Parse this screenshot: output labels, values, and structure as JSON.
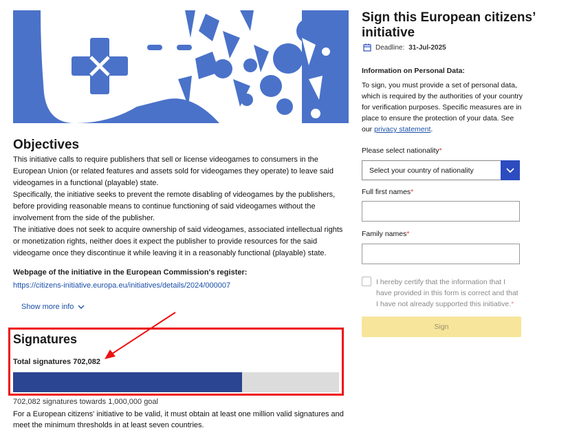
{
  "hero": {
    "image": "videogame-controller-illustration"
  },
  "objectives": {
    "title": "Objectives",
    "paragraphs": [
      "This initiative calls to require publishers that sell or license videogames to consumers in the European Union (or related features and assets sold for videogames they operate) to leave said videogames in a functional (playable) state.",
      "Specifically, the initiative seeks to prevent the remote disabling of videogames by the publishers, before providing reasonable means to continue functioning of said videogames without the involvement from the side of the publisher.",
      "The initiative does not seek to acquire ownership of said videogames, associated intellectual rights or monetization rights, neither does it expect the publisher to provide resources for the said videogame once they discontinue it while leaving it in a reasonably functional (playable) state."
    ],
    "webpage_label": "Webpage of the initiative in the European Commission's register:",
    "webpage_link": "https://citizens-initiative.europa.eu/initiatives/details/2024/000007",
    "show_more": "Show more info"
  },
  "signatures": {
    "title": "Signatures",
    "total_label": "Total signatures 702,082",
    "progress_fraction": 0.702082,
    "goal_text": "702,082 signatures towards 1,000,000 goal",
    "validity_text": "For a European citizens' initiative to be valid, it must obtain at least one million valid signatures and meet the minimum thresholds in at least seven countries."
  },
  "sidebar": {
    "title": "Sign this European citizens’ initiative",
    "deadline_label": "Deadline:",
    "deadline_value": "31-Jul-2025",
    "info_title": "Information on Personal Data:",
    "info_text": "To sign, you must provide a set of personal data, which is required by the authorities of your country for verification purposes. Specific measures are in place to ensure the protection of your data. See our",
    "info_link": "privacy statement",
    "nationality_label": "Please select nationality",
    "nationality_placeholder": "Select your country of nationality",
    "first_names_label": "Full first names",
    "family_names_label": "Family names",
    "required_mark": "*",
    "certify_text": "I hereby certify that the information that I have provided in this form is correct and that I have not already supported this initiative.",
    "sign_button": "Sign"
  },
  "colors": {
    "accent": "#2c4cc0",
    "progress": "#2c4592",
    "highlight": "#e11111",
    "sign_disabled": "#f7e59c"
  }
}
